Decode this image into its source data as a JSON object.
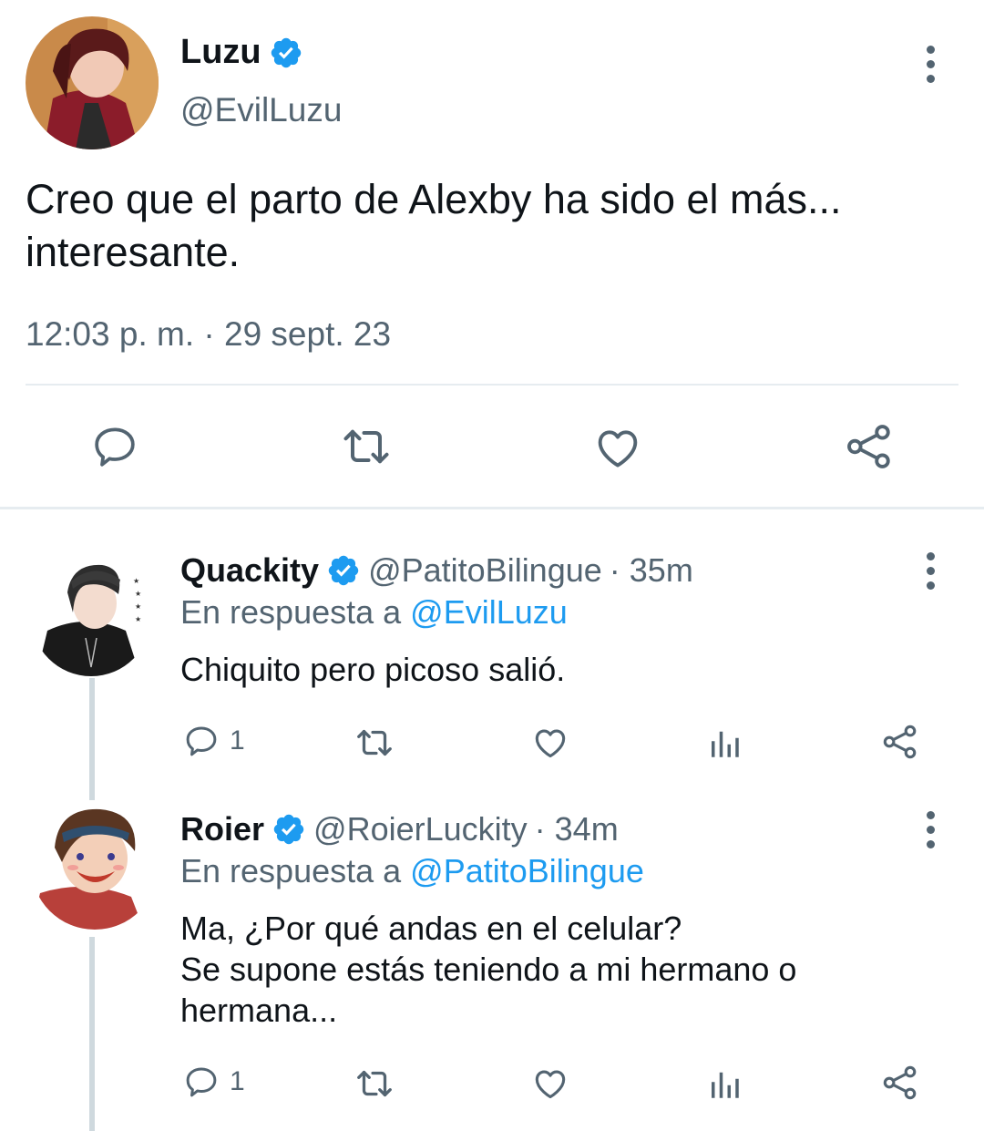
{
  "main_tweet": {
    "display_name": "Luzu",
    "handle": "@EvilLuzu",
    "text_line1": "Creo que el parto de Alexby ha sido el más...",
    "text_line2": "interesante.",
    "timestamp": "12:03 p. m. · 29 sept. 23",
    "actions": [
      "reply-icon",
      "retweet-icon",
      "like-icon",
      "share-icon"
    ]
  },
  "replies": [
    {
      "display_name": "Quackity",
      "handle": "@PatitoBilingue",
      "time": "· 35m",
      "in_reply_prefix": "En respuesta a",
      "in_reply_to": "@EvilLuzu",
      "text_lines": [
        "Chiquito pero picoso salió."
      ],
      "reply_count": "1"
    },
    {
      "display_name": "Roier",
      "handle": "@RoierLuckity",
      "time": "· 34m",
      "in_reply_prefix": "En respuesta a",
      "in_reply_to": "@PatitoBilingue",
      "text_lines": [
        "Ma, ¿Por qué andas en el celular?",
        "Se supone estás teniendo a mi hermano o",
        "hermana..."
      ],
      "reply_count": "1"
    }
  ],
  "colors": {
    "text": "#0f1419",
    "secondary": "#536471",
    "link": "#1d9bf0",
    "verified": "#1d9bf0"
  }
}
